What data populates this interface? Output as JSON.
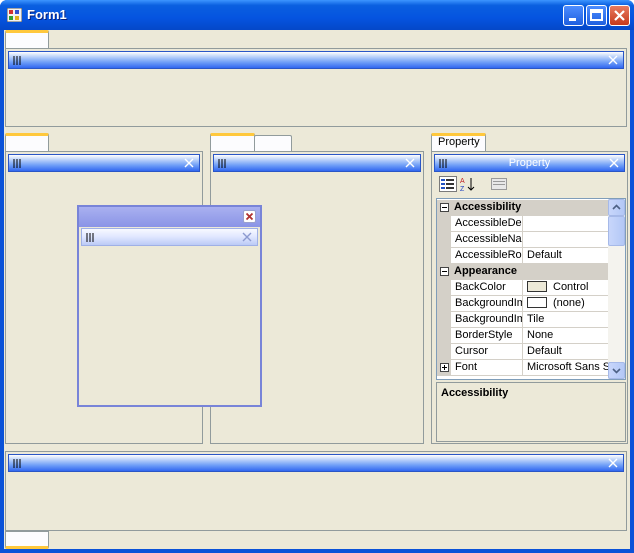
{
  "window": {
    "title": "Form1",
    "buttons": [
      "minimize",
      "maximize",
      "close"
    ]
  },
  "colors": {
    "titlebar": "#0554e0",
    "client": "#ece9d8",
    "tab_highlight": "#ffc83c",
    "caption_blue": "#3167f0"
  },
  "property_tab": {
    "label": "Property"
  },
  "property_panel": {
    "caption": "Property"
  },
  "property_grid": {
    "categories": [
      {
        "name": "Accessibility",
        "rows": [
          {
            "name": "AccessibleDes",
            "value": ""
          },
          {
            "name": "AccessibleNar",
            "value": ""
          },
          {
            "name": "AccessibleRol",
            "value": "Default"
          }
        ]
      },
      {
        "name": "Appearance",
        "rows": [
          {
            "name": "BackColor",
            "value": "Control"
          },
          {
            "name": "BackgroundIm",
            "value": "(none)"
          },
          {
            "name": "BackgroundIm",
            "value": "Tile"
          },
          {
            "name": "BorderStyle",
            "value": "None"
          },
          {
            "name": "Cursor",
            "value": "Default"
          },
          {
            "name": "Font",
            "value": "Microsoft Sans Se"
          }
        ]
      }
    ],
    "description_title": "Accessibility"
  }
}
